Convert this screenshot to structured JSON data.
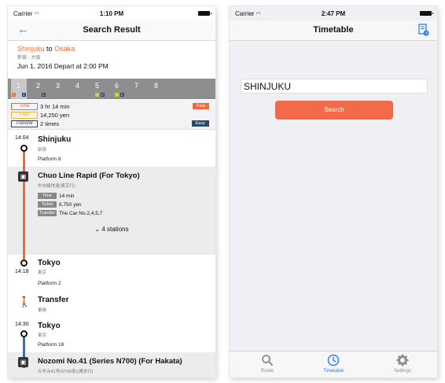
{
  "left": {
    "status": {
      "carrier": "Carrier",
      "time": "1:10 PM"
    },
    "nav": {
      "title": "Search Result"
    },
    "summary": {
      "from": "Shinjuku",
      "to_word": "to",
      "to": "Osaka",
      "kanji": "新宿 - 大阪",
      "depart": "Jun 1, 2016 Depart at 2:00 PM"
    },
    "route_tabs": [
      "1",
      "2",
      "3",
      "4",
      "5",
      "6",
      "7",
      "8"
    ],
    "tab_marks": [
      "F",
      "E",
      "E",
      "Y",
      "E",
      "Y",
      "E"
    ],
    "info": {
      "time_tag": "Time",
      "time_value": "3 hr 14 min",
      "fare_tag": "Fare",
      "fare_value": "14,250 yen",
      "transfer_tag": "Transfer",
      "transfer_value": "2 times",
      "badge_fast": "Fast",
      "badge_easy": "Easy"
    },
    "timeline": {
      "stop1": {
        "time": "14:04",
        "name": "Shinjuku",
        "kanji": "新宿",
        "platform": "Platform 8"
      },
      "train1": {
        "name": "Chuo Line Rapid (For Tokyo)",
        "kanji": "中央線快速(東京行)",
        "time_tag": "Time",
        "time_value": "14 min",
        "ticket_tag": "Ticket",
        "ticket_value": "8,750 yen",
        "transfer_tag": "Transfer",
        "transfer_value": "The Car No.2,4,5,7",
        "stations": "4 stations"
      },
      "stop2": {
        "time": "14:18",
        "name": "Tokyo",
        "kanji": "東京",
        "platform": "Platform 2"
      },
      "transfer": {
        "name": "Transfer",
        "kanji": "乗換"
      },
      "stop3": {
        "time": "14:30",
        "name": "Tokyo",
        "kanji": "東京",
        "platform": "Platform 18"
      },
      "train2": {
        "name": "Nozomi No.41 (Series N700) (For Hakata)",
        "kanji": "のぞみ41号(N700系)(博多行)"
      }
    }
  },
  "right": {
    "status": {
      "carrier": "Carrier",
      "time": "2:47 PM"
    },
    "nav": {
      "title": "Timetable"
    },
    "search": {
      "value": "SHINJUKU",
      "button": "Search"
    },
    "tabbar": {
      "route": "Route",
      "timetable": "Timetable",
      "settings": "Settings"
    }
  },
  "colors": {
    "accent": "#f26a3b",
    "blue": "#2e7cf6",
    "navy": "#2a4a6b"
  },
  "icons": [
    "back-arrow-icon",
    "train-icon",
    "walk-icon",
    "search-icon",
    "clock-icon",
    "gear-icon",
    "timetable-icon",
    "wifi-icon",
    "battery-icon"
  ]
}
